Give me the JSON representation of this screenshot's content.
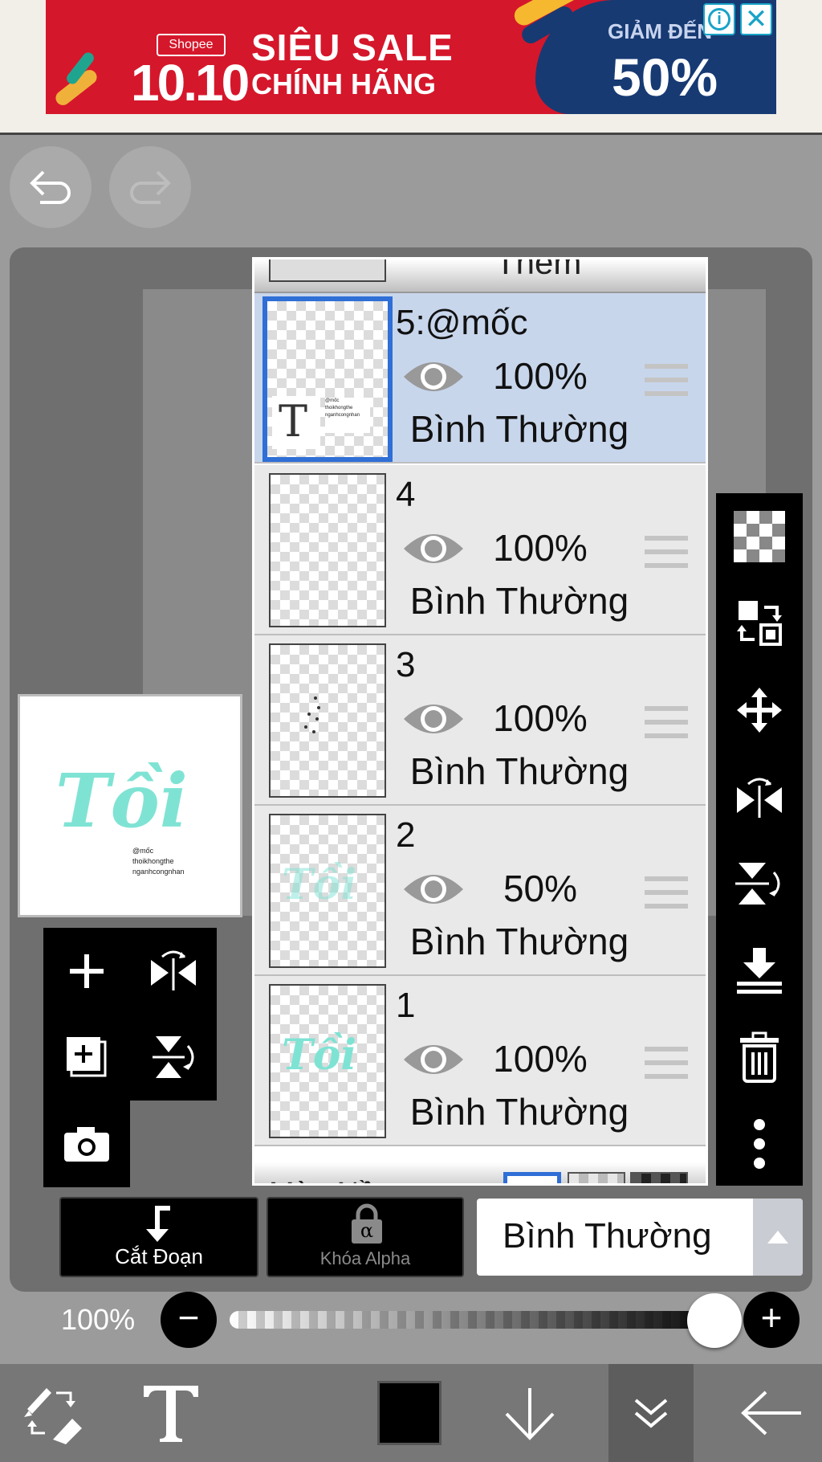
{
  "ad": {
    "brand": "Shopee",
    "date": "10.10",
    "title": "SIÊU SALE",
    "subtitle": "CHÍNH HÃNG",
    "discount_label": "GIẢM ĐẾN",
    "discount_value": "50%",
    "colors": {
      "red": "#d5172b",
      "navy": "#173a73"
    }
  },
  "layers_panel": {
    "top_label": "Thêm",
    "layers": [
      {
        "name": "5:@mốc",
        "opacity": "100%",
        "blend": "Bình Thường",
        "selected": true
      },
      {
        "name": "4",
        "opacity": "100%",
        "blend": "Bình Thường",
        "selected": false
      },
      {
        "name": "3",
        "opacity": "100%",
        "blend": "Bình Thường",
        "selected": false
      },
      {
        "name": "2",
        "opacity": "50%",
        "blend": "Bình Thường",
        "selected": false
      },
      {
        "name": "1",
        "opacity": "100%",
        "blend": "Bình Thường",
        "selected": false
      }
    ],
    "background_label": "Màu Nền",
    "thumb_text_layer_glyph": "T",
    "thumb_artwork_text": "Tồi"
  },
  "preview": {
    "artwork_text": "Tồi",
    "small_lines": [
      "@mốc",
      "thoikhongthe",
      "nganhcongnhan"
    ]
  },
  "controls": {
    "clipping_label": "Cắt Đoạn",
    "alpha_lock_label": "Khóa Alpha",
    "alpha_glyph": "α",
    "blend_mode": "Bình Thường",
    "opacity_label": "100%",
    "opacity_value": 1.0
  },
  "accent_color": "#2f6fd6",
  "art_color": "#7fe3d4"
}
